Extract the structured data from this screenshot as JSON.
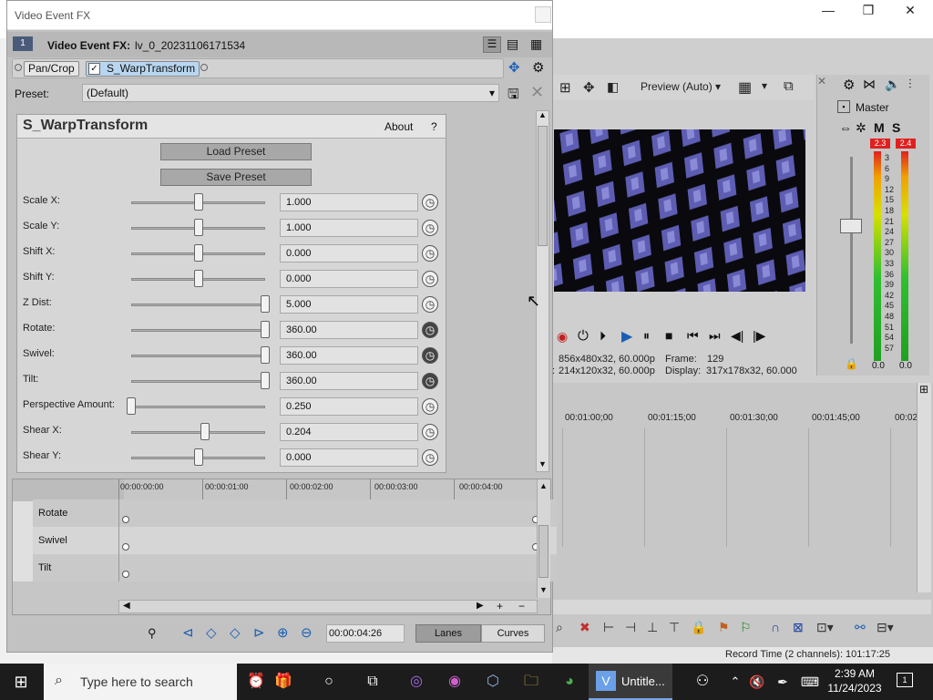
{
  "fx_dialog": {
    "title": "Video Event FX",
    "event_badge": "1",
    "event_label": "Video Event FX:",
    "event_name": "lv_0_20231106171534",
    "chain": [
      "Pan/Crop",
      "S_WarpTransform"
    ],
    "preset_label": "Preset:",
    "preset_value": "(Default)",
    "plugin": {
      "name": "S_WarpTransform",
      "about": "About",
      "help": "?",
      "load_preset": "Load Preset",
      "save_preset": "Save Preset",
      "params": [
        {
          "label": "Scale X:",
          "value": "1.000",
          "level": 0.5,
          "animated": false
        },
        {
          "label": "Scale Y:",
          "value": "1.000",
          "level": 0.5,
          "animated": false
        },
        {
          "label": "Shift X:",
          "value": "0.000",
          "level": 0.5,
          "animated": false
        },
        {
          "label": "Shift Y:",
          "value": "0.000",
          "level": 0.5,
          "animated": false
        },
        {
          "label": "Z Dist:",
          "value": "5.000",
          "level": 1.0,
          "animated": false
        },
        {
          "label": "Rotate:",
          "value": "360.00",
          "level": 1.0,
          "animated": true
        },
        {
          "label": "Swivel:",
          "value": "360.00",
          "level": 1.0,
          "animated": true
        },
        {
          "label": "Tilt:",
          "value": "360.00",
          "level": 1.0,
          "animated": true
        },
        {
          "label": "Perspective Amount:",
          "value": "0.250",
          "level": 0.0,
          "animated": false
        },
        {
          "label": "Shear X:",
          "value": "0.204",
          "level": 0.55,
          "animated": false
        },
        {
          "label": "Shear Y:",
          "value": "0.000",
          "level": 0.5,
          "animated": false
        }
      ]
    },
    "keyframes": {
      "ruler": [
        "00:00:00:00",
        "00:00:01:00",
        "00:00:02:00",
        "00:00:03:00",
        "00:00:04:00"
      ],
      "lanes": [
        "Rotate",
        "Swivel",
        "Tilt"
      ],
      "timecode": "00:00:04:26",
      "tabs": [
        "Lanes",
        "Curves"
      ]
    }
  },
  "host": {
    "preview_mode": "Preview (Auto)",
    "info": {
      "project": "856x480x32, 60.000p",
      "frame_label": "Frame:",
      "frame": "129",
      "preview": "214x120x32, 60.000p",
      "display_label": "Display:",
      "display": "317x178x32, 60.000"
    },
    "master": {
      "label": "Master",
      "m": "M",
      "s": "S",
      "peak_l": "2.3",
      "peak_r": "2.4",
      "scale": [
        "3",
        "6",
        "9",
        "12",
        "15",
        "18",
        "21",
        "24",
        "27",
        "30",
        "33",
        "36",
        "39",
        "42",
        "45",
        "48",
        "51",
        "54",
        "57"
      ],
      "level_l": "0.0",
      "level_r": "0.0"
    },
    "timeline_ruler": [
      "00:01:00;00",
      "00:01:15;00",
      "00:01:30;00",
      "00:01:45;00",
      "00:02"
    ],
    "status": "Record Time (2 channels): 101:17:25"
  },
  "window_controls": {
    "minimize": "—",
    "maximize": "❐",
    "close": "✕"
  },
  "taskbar": {
    "search_placeholder": "Type here to search",
    "active_app": "Untitle...",
    "time": "2:39 AM",
    "date": "11/24/2023",
    "notifications": "1"
  },
  "colors": {
    "accent_chip": "#b8d6f0",
    "meter_red": "#e02020",
    "taskbar": "#1c1c1c"
  }
}
